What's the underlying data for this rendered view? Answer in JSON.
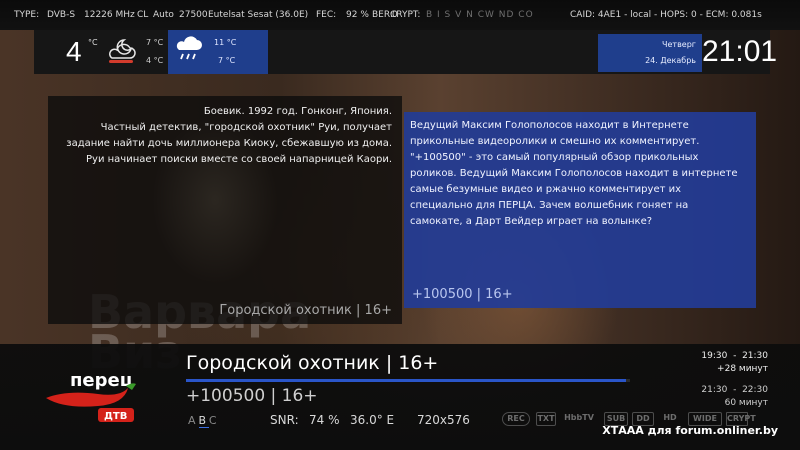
{
  "tech_bar": {
    "type": "TYPE:",
    "system": "DVB-S",
    "frequency": "12226 MHz",
    "cl": "CL",
    "mode": "Auto",
    "symbol_rate": "27500",
    "satellite": "Eutelsat Sesat (36.0E)",
    "fec": "FEC:",
    "signal_pct": "92 %",
    "ber": "BER:",
    "ber_val": "0",
    "crypt": "CRYPT:",
    "crypt_systems": "B I S V N CW ND CO",
    "caid": "CAID: 4AE1 - local - HOPS: 0 - ECM: 0.081s"
  },
  "weather": {
    "now_temp": "4",
    "unit": "°C",
    "now_max": "7 °C",
    "now_min": "4 °C",
    "next_max": "11 °C",
    "next_min": "7 °C",
    "now_icon": "cloudy-night-icon",
    "next_icon": "rain-cloud-icon"
  },
  "clock": {
    "weekday": "Четверг",
    "date": "24. Декабрь",
    "time": "21:01"
  },
  "panel_left": {
    "description": "Боевик. 1992 год. Гонконг, Япония.\nЧастный детектив, \"городской охотник\" Руи, получает задание найти дочь миллионера Киоку, сбежавшую из дома. Руи начинает поиски вместе со своей напарницей Каори.",
    "footer": "Городской охотник | 16+"
  },
  "panel_right": {
    "description": "Ведущий Максим Голополосов находит в Интернете прикольные видеоролики и смешно их комментирует. \"+100500\" - это самый популярный обзор прикольных роликов. Ведущий Максим Голополосов находит в интернете самые безумные видео и ржачно комментирует их специально для ПЕРЦА. Зачем волшебник гоняет на самокате, а Дарт Вейдер играет на волынке?",
    "footer": "+100500 | 16+"
  },
  "video": {
    "watermark": "Варвара\nВиз"
  },
  "infobar": {
    "channel_logo_text": "перец",
    "channel_logo_sub": "ДТВ",
    "event_now": "Городской охотник | 16+",
    "event_next": "+100500 | 16+",
    "progress_fraction": 0.99,
    "now_start": "19:30",
    "now_end": "21:30",
    "now_remaining": "+28 минут",
    "next_start": "21:30",
    "next_end": "22:30",
    "next_duration": "60 минут",
    "audio": [
      "A",
      "B",
      "C"
    ],
    "snr_label": "SNR:",
    "snr_value": "74 %",
    "orbital": "36.0° E",
    "resolution": "720x576",
    "icons": [
      "REC",
      "TXT",
      "HbbTV",
      "SUB",
      "DD",
      "HD",
      "WIDE",
      "CRYPT"
    ],
    "colors": {
      "accent": "#2a55c8",
      "panel_blue": "#233c96"
    }
  },
  "credit": "ХТААА для forum.onliner.by"
}
